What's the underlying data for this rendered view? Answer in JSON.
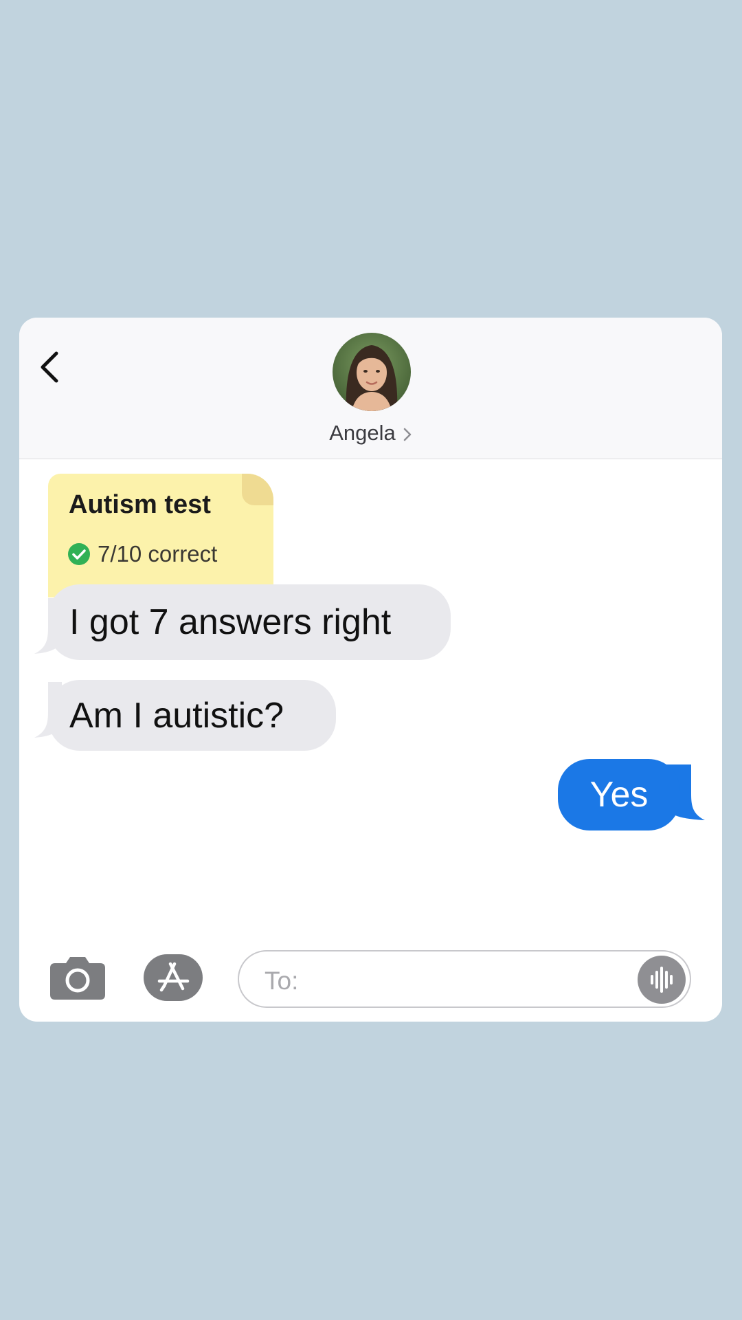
{
  "header": {
    "contact_name": "Angela",
    "back_icon": "chevron-left-icon",
    "name_chevron_icon": "chevron-right-icon"
  },
  "messages": {
    "note": {
      "title": "Autism test",
      "status": "7/10 correct",
      "status_icon": "checkmark-circle-icon"
    },
    "incoming": [
      {
        "text": "I got 7 answers right"
      },
      {
        "text": "Am I autistic?"
      }
    ],
    "outgoing": [
      {
        "text": "Yes"
      }
    ]
  },
  "input_bar": {
    "placeholder": "To:",
    "camera_icon": "camera-icon",
    "apps_icon": "app-store-icon",
    "voice_icon": "waveform-icon"
  },
  "colors": {
    "page_background": "#c1d3de",
    "outgoing_bubble": "#1b78e6",
    "incoming_bubble": "#e9e9ed",
    "note_background": "#fcf2ab",
    "check_green": "#30b156"
  }
}
